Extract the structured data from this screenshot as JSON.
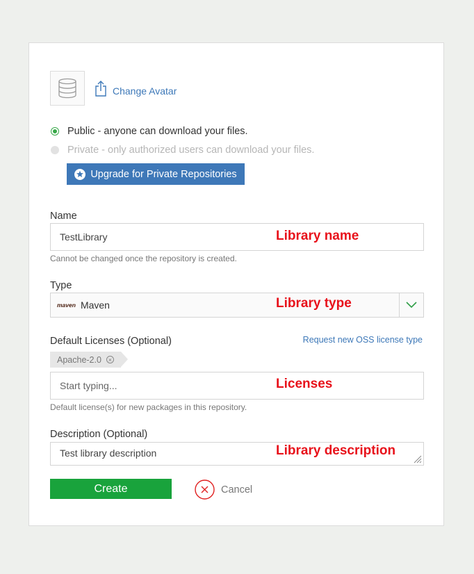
{
  "avatar": {
    "icon": "database-icon",
    "upload_icon": "upload-icon",
    "change_label": "Change Avatar"
  },
  "visibility": {
    "public_label": "Public - anyone can download your files.",
    "private_label": "Private - only authorized users can download your files.",
    "selected": "public",
    "upgrade_label": "Upgrade for Private Repositories",
    "upgrade_icon": "star-circle-icon"
  },
  "name": {
    "label": "Name",
    "value": "TestLibrary",
    "annotation": "Library name",
    "help": "Cannot be changed once the repository is created."
  },
  "type": {
    "label": "Type",
    "logo_text": "maven",
    "value": "Maven",
    "annotation": "Library type"
  },
  "licenses": {
    "label": "Default Licenses (Optional)",
    "request_link": "Request new OSS license type",
    "tags": [
      "Apache-2.0"
    ],
    "placeholder": "Start typing...",
    "annotation": "Licenses",
    "help": "Default license(s) for new packages in this repository."
  },
  "description": {
    "label": "Description (Optional)",
    "value": "Test library description",
    "annotation": "Library description"
  },
  "actions": {
    "create_label": "Create",
    "cancel_label": "Cancel"
  },
  "colors": {
    "accent_blue": "#3e78b8",
    "create_green": "#19a33c",
    "radio_green": "#37a848",
    "annotation_red": "#e8121b",
    "cancel_red": "#e02020"
  }
}
